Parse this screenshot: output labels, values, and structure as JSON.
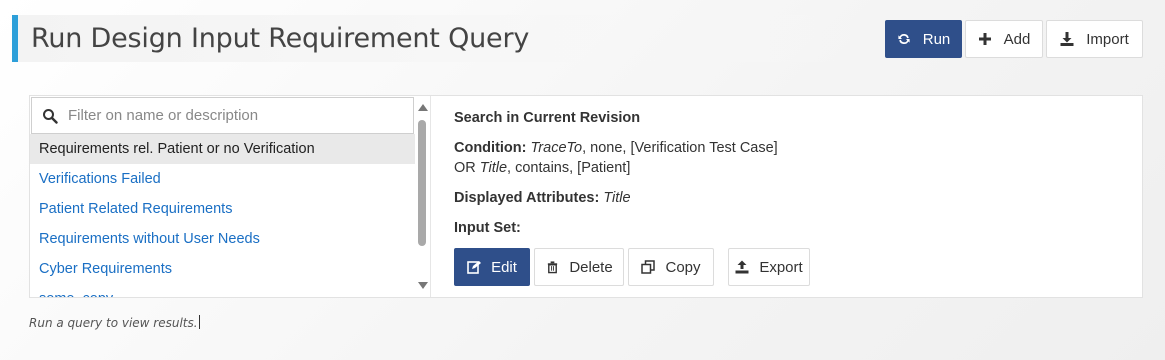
{
  "header": {
    "title": "Run Design Input Requirement Query"
  },
  "toolbar": {
    "run_label": "Run",
    "add_label": "Add",
    "import_label": "Import"
  },
  "query_list": {
    "filter_placeholder": "Filter on name or description",
    "filter_value": "",
    "items": [
      {
        "label": "Requirements rel. Patient or no Verification",
        "selected": true
      },
      {
        "label": "Verifications Failed"
      },
      {
        "label": "Patient Related Requirements"
      },
      {
        "label": "Requirements without User Needs"
      },
      {
        "label": "Cyber Requirements"
      },
      {
        "label": "some_copy"
      }
    ]
  },
  "detail": {
    "search_scope": "Search in Current Revision",
    "condition_label": "Condition:",
    "condition_line1_attr": "TraceTo",
    "condition_line1_rest": ", none, [Verification Test Case]",
    "condition_line2_prefix": "OR ",
    "condition_line2_attr": "Title",
    "condition_line2_rest": ", contains, [Patient]",
    "displayed_label": "Displayed Attributes:",
    "displayed_value": "Title",
    "input_set_label": "Input Set:",
    "edit_label": "Edit",
    "delete_label": "Delete",
    "copy_label": "Copy",
    "export_label": "Export"
  },
  "status": {
    "text": "Run a query to view results."
  },
  "colors": {
    "accent": "#2d9fd9",
    "primary": "#2f4f8a",
    "link": "#1a6fc4"
  },
  "icons": {
    "run": "refresh-icon",
    "add": "plus-icon",
    "import": "import-icon",
    "search": "search-icon",
    "edit": "edit-icon",
    "delete": "trash-icon",
    "copy": "copy-icon",
    "export": "export-icon"
  }
}
